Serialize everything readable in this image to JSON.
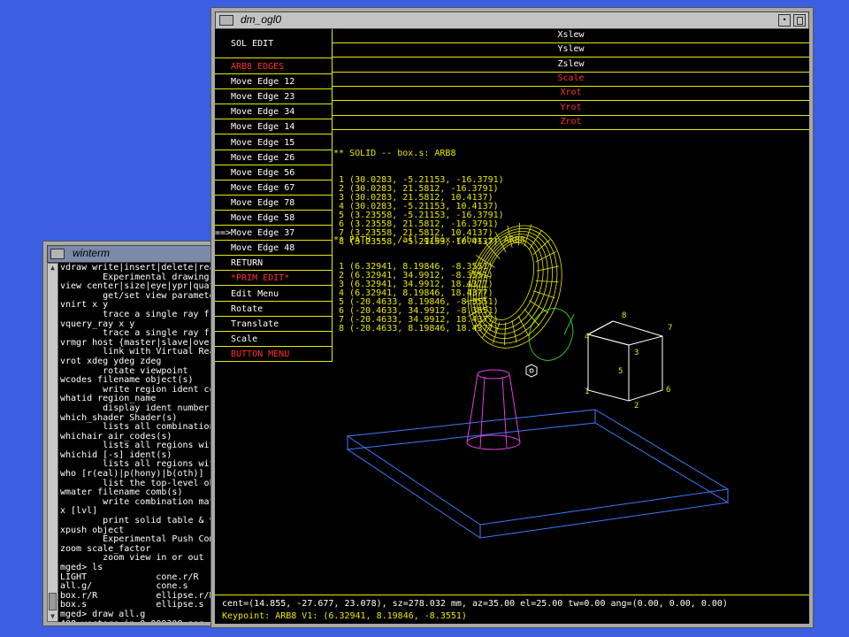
{
  "winterm": {
    "title": "winterm",
    "lines": [
      "vdraw write|insert|delete|read|",
      "        Experimental drawing (cn",
      "view center|size|eye|ypr|quat|a",
      "        get/set view parameters",
      "vnirt x y",
      "        trace a single ray from",
      "vquery_ray x y",
      "        trace a single ray from",
      "vrmgr host {master|slave|overvi",
      "        link with Virtual Reali",
      "vrot xdeg ydeg zdeg",
      "        rotate viewpoint",
      "wcodes filename object(s)",
      "        write region ident codes",
      "whatid region_name",
      "        display ident number fo",
      "which_shader Shader(s)",
      "        lists all combinations o",
      "whichair air_codes(s)",
      "        lists all regions with a",
      "whichid [-s] ident(s)",
      "        lists all regions with i",
      "who [r(eal)|p(hony)|b(oth)]",
      "        list the top-level objec",
      "wmater filename comb(s)",
      "        write combination mater",
      "x [lvl]",
      "        print solid table & vect",
      "xpush object",
      "        Experimental Push Comman",
      "zoom scale_factor",
      "        zoom view in or out",
      "mged> ls",
      "LIGHT             cone.r/R",
      "all.g/            cone.s",
      "box.r/R           ellipse.r/R",
      "box.s             ellipse.s",
      "mged> draw all.g",
      "408 vectors in 0.009308 sec"
    ],
    "prompt": "mged> "
  },
  "ogl": {
    "title": "dm_ogl0",
    "menu_header": "SOL EDIT",
    "menu_items": [
      {
        "label": "ARB8 EDGES",
        "red": true
      },
      {
        "label": "Move Edge 12"
      },
      {
        "label": "Move Edge 23"
      },
      {
        "label": "Move Edge 34"
      },
      {
        "label": "Move Edge 14"
      },
      {
        "label": "Move Edge 15"
      },
      {
        "label": "Move Edge 26"
      },
      {
        "label": "Move Edge 56"
      },
      {
        "label": "Move Edge 67"
      },
      {
        "label": "Move Edge 78"
      },
      {
        "label": "Move Edge 58"
      },
      {
        "label": "==>Move Edge 37",
        "selected": true
      },
      {
        "label": "Move Edge 48"
      },
      {
        "label": "RETURN"
      },
      {
        "label": "*PRIM EDIT*",
        "red": true
      },
      {
        "label": "Edit Menu"
      },
      {
        "label": "Rotate"
      },
      {
        "label": "Translate"
      },
      {
        "label": "Scale"
      },
      {
        "label": "BUTTON MENU",
        "red": true
      }
    ],
    "sliders": [
      {
        "label": "Xslew"
      },
      {
        "label": "Yslew"
      },
      {
        "label": "Zslew"
      },
      {
        "label": "Scale",
        "red": true
      },
      {
        "label": "Xrot",
        "red": true
      },
      {
        "label": "Yrot",
        "red": true
      },
      {
        "label": "Zrot",
        "red": true
      }
    ],
    "solid_header": "** SOLID -- box.s: ARB8",
    "solid_lines": [
      " 1 (30.0283, -5.21153, -16.3791)",
      " 2 (30.0283, 21.5812, -16.3791)",
      " 3 (30.0283, 21.5812, 10.4137)",
      " 4 (30.0283, -5.21153, 10.4137)",
      " 5 (3.23558, -5.21153, -16.3791)",
      " 6 (3.23558, 21.5812, -16.3791)",
      " 7 (3.23558, 21.5812, 10.4137)",
      " 8 (3.23558, -5.21153, 10.4137)"
    ],
    "path_header": "** PATH --  /all.g/box.r/box.s: ARB8",
    "path_lines": [
      " 1 (6.32941, 8.19846, -8.3551)",
      " 2 (6.32941, 34.9912, -8.3551)",
      " 3 (6.32941, 34.9912, 18.4377)",
      " 4 (6.32941, 8.19846, 18.4377)",
      " 5 (-20.4633, 8.19846, -8.3551)",
      " 6 (-20.4633, 34.9912, -8.3551)",
      " 7 (-20.4633, 34.9912, 18.4377)",
      " 8 (-20.4633, 8.19846, 18.4377)"
    ],
    "vertex_labels": [
      "1",
      "2",
      "3",
      "4",
      "5",
      "6",
      "7",
      "8"
    ],
    "status_line": "cent=(14.855, -27.677, 23.078), sz=278.032 mm, az=35.00 el=25.00 tw=0.00 ang=(0.00, 0.00, 0.00)",
    "keypoint_line": "Keypoint: ARB8 V1: (6.32941, 8.19846, -8.3551)",
    "colors": {
      "yellow": "#e8e800",
      "red": "#ff3030",
      "blue": "#3b7bff",
      "magenta": "#e040e0",
      "green": "#30c030",
      "torus": "#e8e800"
    }
  }
}
